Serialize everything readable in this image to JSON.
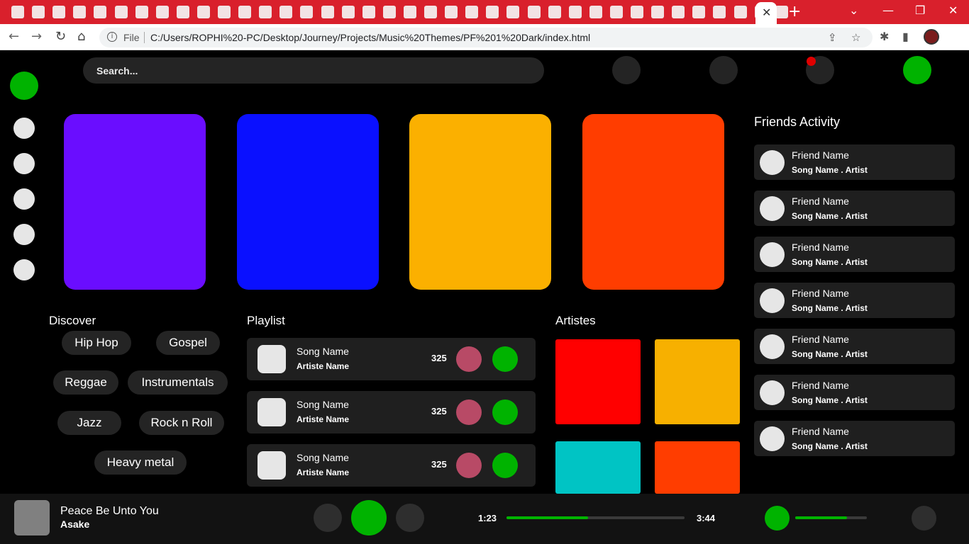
{
  "browser": {
    "tab_count": 38,
    "omnibox_scheme": "File",
    "url": "C:/Users/ROPHI%20-PC/Desktop/Journey/Projects/Music%20Themes/PF%201%20Dark/index.html",
    "tab_close": "✕",
    "new_tab": "+",
    "minimize": "—",
    "restore": "❐",
    "close": "✕",
    "back": "←",
    "forward": "→",
    "reload": "↻",
    "home": "⌂",
    "info": "i",
    "share": "⇪",
    "star": "☆",
    "extensions": "✱",
    "sidepanel": "▮",
    "chevron": "⌄"
  },
  "search": {
    "placeholder": "Search..."
  },
  "cards": [
    "#6a0dff",
    "#0a10ff",
    "#fbb000",
    "#ff3d00"
  ],
  "discover": {
    "title": "Discover",
    "genres": [
      "Hip Hop",
      "Gospel",
      "Reggae",
      "Instrumentals",
      "Jazz",
      "Rock n Roll",
      "Heavy metal"
    ]
  },
  "playlist": {
    "title": "Playlist",
    "rows": [
      {
        "song": "Song Name",
        "artist": "Artiste Name",
        "count": "325"
      },
      {
        "song": "Song Name",
        "artist": "Artiste Name",
        "count": "325"
      },
      {
        "song": "Song Name",
        "artist": "Artiste Name",
        "count": "325"
      }
    ]
  },
  "artistes": {
    "title": "Artistes",
    "tile_colors": [
      "#ff0000",
      "#f7b000",
      "#00c4c4",
      "#ff3d00"
    ]
  },
  "friends": {
    "title": "Friends Activity",
    "rows": [
      {
        "name": "Friend Name",
        "song": "Song Name . Artist"
      },
      {
        "name": "Friend Name",
        "song": "Song Name . Artist"
      },
      {
        "name": "Friend Name",
        "song": "Song Name . Artist"
      },
      {
        "name": "Friend Name",
        "song": "Song Name . Artist"
      },
      {
        "name": "Friend Name",
        "song": "Song Name . Artist"
      },
      {
        "name": "Friend Name",
        "song": "Song Name . Artist"
      },
      {
        "name": "Friend Name",
        "song": "Song Name . Artist"
      }
    ]
  },
  "player": {
    "title": "Peace Be Unto You",
    "artist": "Asake",
    "elapsed": "1:23",
    "duration": "3:44",
    "progress": 0.46,
    "volume": 0.72
  },
  "colors": {
    "accent": "#00b300",
    "notification": "#e00000",
    "like": "#b84a66"
  }
}
